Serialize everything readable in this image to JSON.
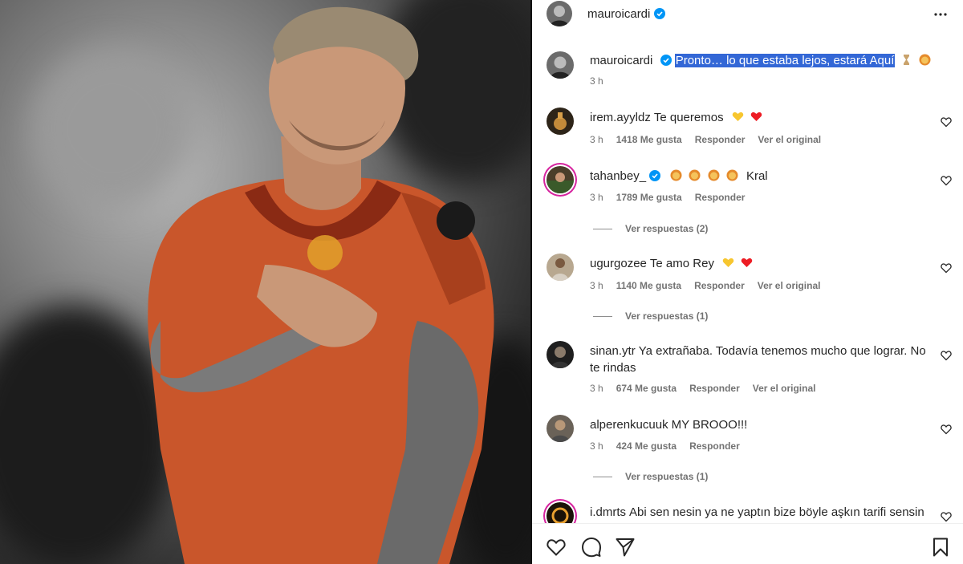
{
  "post": {
    "author": "mauroicardi",
    "verified": true
  },
  "caption": {
    "username": "mauroicardi",
    "text_highlighted": "Pronto… lo que estaba lejos, estará Aquí",
    "emojis": [
      "hourglass-emoji",
      "lion-emoji"
    ],
    "time": "3 h"
  },
  "comments": [
    {
      "username": "irem.ayyldz",
      "text": "Te queremos",
      "emojis": [
        "yellow-heart-emoji",
        "red-heart-emoji"
      ],
      "time": "3 h",
      "likes": "1418 Me gusta",
      "reply": "Responder",
      "translate": "Ver el original"
    },
    {
      "username": "tahanbey_",
      "verified": true,
      "text": "Kral",
      "emojis": [
        "lion-emoji",
        "lion-emoji",
        "lion-emoji",
        "lion-emoji"
      ],
      "time": "3 h",
      "likes": "1789 Me gusta",
      "reply": "Responder",
      "replies": "Ver respuestas (2)"
    },
    {
      "username": "ugurgozee",
      "text": "Te amo Rey",
      "emojis": [
        "yellow-heart-emoji",
        "red-heart-emoji"
      ],
      "time": "3 h",
      "likes": "1140 Me gusta",
      "reply": "Responder",
      "translate": "Ver el original",
      "replies": "Ver respuestas (1)"
    },
    {
      "username": "sinan.ytr",
      "text": "Ya extrañaba. Todavía tenemos mucho que lograr. No te rindas",
      "time": "3 h",
      "likes": "674 Me gusta",
      "reply": "Responder",
      "translate": "Ver el original"
    },
    {
      "username": "alperenkucuuk",
      "text": "MY BROOO!!!",
      "time": "3 h",
      "likes": "424 Me gusta",
      "reply": "Responder",
      "replies": "Ver respuestas (1)"
    },
    {
      "username": "i.dmrts",
      "text": "Abi sen nesin ya ne yaptın bize böyle aşkın tarifi sensin"
    }
  ],
  "footer": {
    "icons": [
      "like-icon",
      "comment-icon",
      "share-icon",
      "save-icon"
    ]
  },
  "colors": {
    "highlight": "#3367d6",
    "verified": "#0095f6",
    "muted": "#737373",
    "heart_red": "#ed1c24",
    "heart_yellow": "#f7c62f",
    "jersey": "#c9562b"
  }
}
